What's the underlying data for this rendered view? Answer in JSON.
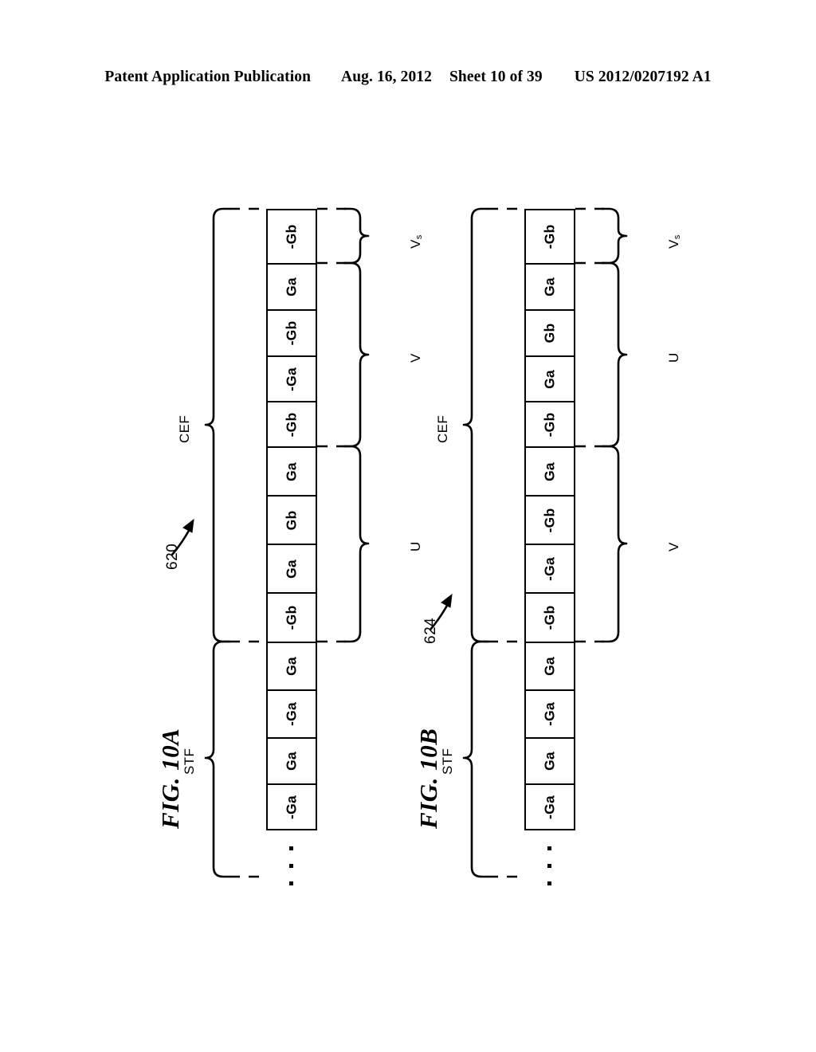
{
  "header": {
    "publication": "Patent Application Publication",
    "date": "Aug. 16, 2012",
    "sheet": "Sheet 10 of 39",
    "patent_number": "US 2012/0207192 A1"
  },
  "figures": [
    {
      "id": "fig-10a",
      "title": "FIG. 10A",
      "ref_numeral": "620",
      "left_braces": [
        {
          "label": "CEF",
          "name": "cef-brace"
        },
        {
          "label": "STF",
          "name": "stf-brace"
        }
      ],
      "right_braces": [
        {
          "label": "V",
          "sub": "s",
          "name": "vs-brace"
        },
        {
          "label": "V",
          "sub": "",
          "name": "v-brace"
        },
        {
          "label": "U",
          "sub": "",
          "name": "u-brace"
        }
      ],
      "cells": [
        "-Gb",
        "Ga",
        "-Gb",
        "-Ga",
        "-Gb",
        "Ga",
        "Gb",
        "Ga",
        "-Gb",
        "Ga",
        "-Ga",
        "Ga",
        "-Ga"
      ],
      "ellipsis": "⋮"
    },
    {
      "id": "fig-10b",
      "title": "FIG. 10B",
      "ref_numeral": "624",
      "left_braces": [
        {
          "label": "CEF",
          "name": "cef-brace"
        },
        {
          "label": "STF",
          "name": "stf-brace"
        }
      ],
      "right_braces": [
        {
          "label": "V",
          "sub": "s",
          "name": "vs-brace"
        },
        {
          "label": "U",
          "sub": "",
          "name": "u-brace"
        },
        {
          "label": "V",
          "sub": "",
          "name": "v-brace"
        }
      ],
      "cells": [
        "-Gb",
        "Ga",
        "Gb",
        "Ga",
        "-Gb",
        "Ga",
        "-Gb",
        "-Ga",
        "-Gb",
        "Ga",
        "-Ga",
        "Ga",
        "-Ga"
      ],
      "ellipsis": "⋮"
    }
  ],
  "colors": {
    "ink": "#000000",
    "paper": "#ffffff"
  }
}
